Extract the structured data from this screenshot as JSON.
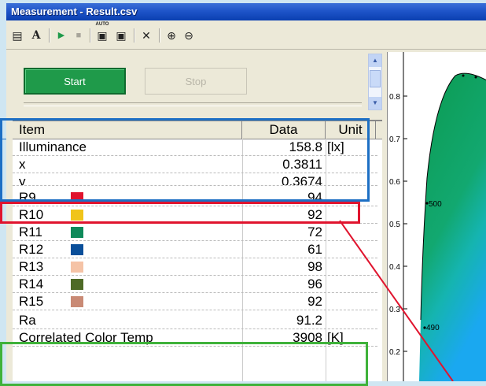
{
  "window": {
    "title": "Measurement - Result.csv"
  },
  "toolbar": {
    "items": [
      {
        "name": "list-icon",
        "glyph": "▤"
      },
      {
        "name": "font-icon",
        "glyph": "A"
      },
      {
        "name": "play-icon",
        "glyph": "▶"
      },
      {
        "name": "stop-icon",
        "glyph": "■"
      },
      {
        "name": "auto-save-icon",
        "glyph": "▣"
      },
      {
        "name": "save-icon",
        "glyph": "▣"
      },
      {
        "name": "tools-icon",
        "glyph": "✕"
      },
      {
        "name": "zoom-in-icon",
        "glyph": "⊕"
      },
      {
        "name": "zoom-out-icon",
        "glyph": "⊖"
      }
    ],
    "auto_label": "AUTO"
  },
  "controls": {
    "start_label": "Start",
    "stop_label": "Stop"
  },
  "table": {
    "headers": {
      "item": "Item",
      "data": "Data",
      "unit": "Unit"
    },
    "rows": [
      {
        "item": "Illuminance",
        "value": "158.8",
        "unit": "[lx]"
      },
      {
        "item": "x",
        "value": "0.3811",
        "unit": ""
      },
      {
        "item": "y",
        "value": "0.3674",
        "unit": ""
      },
      {
        "item": "R9",
        "value": "94",
        "unit": "",
        "swatch": "#e0142e"
      },
      {
        "item": "R10",
        "value": "92",
        "unit": "",
        "swatch": "#f0c419"
      },
      {
        "item": "R11",
        "value": "72",
        "unit": "",
        "swatch": "#0e8a5a"
      },
      {
        "item": "R12",
        "value": "61",
        "unit": "",
        "swatch": "#0a4f9a"
      },
      {
        "item": "R13",
        "value": "98",
        "unit": "",
        "swatch": "#f5c3a6"
      },
      {
        "item": "R14",
        "value": "96",
        "unit": "",
        "swatch": "#4e6a26"
      },
      {
        "item": "R15",
        "value": "92",
        "unit": "",
        "swatch": "#c98a75"
      },
      {
        "item": "Ra",
        "value": "91.2",
        "unit": ""
      },
      {
        "item": "Correlated Color Temp",
        "value": "3908",
        "unit": "[K]"
      }
    ]
  },
  "chart": {
    "y_ticks": [
      "0.8",
      "0.7",
      "0.6",
      "0.5",
      "0.4",
      "0.3",
      "0.2"
    ],
    "wavelength_labels": [
      "500",
      "490"
    ]
  },
  "colors": {
    "highlight_blue": "#1d6fc4",
    "highlight_red": "#e0142e",
    "highlight_green": "#3fb23a"
  }
}
